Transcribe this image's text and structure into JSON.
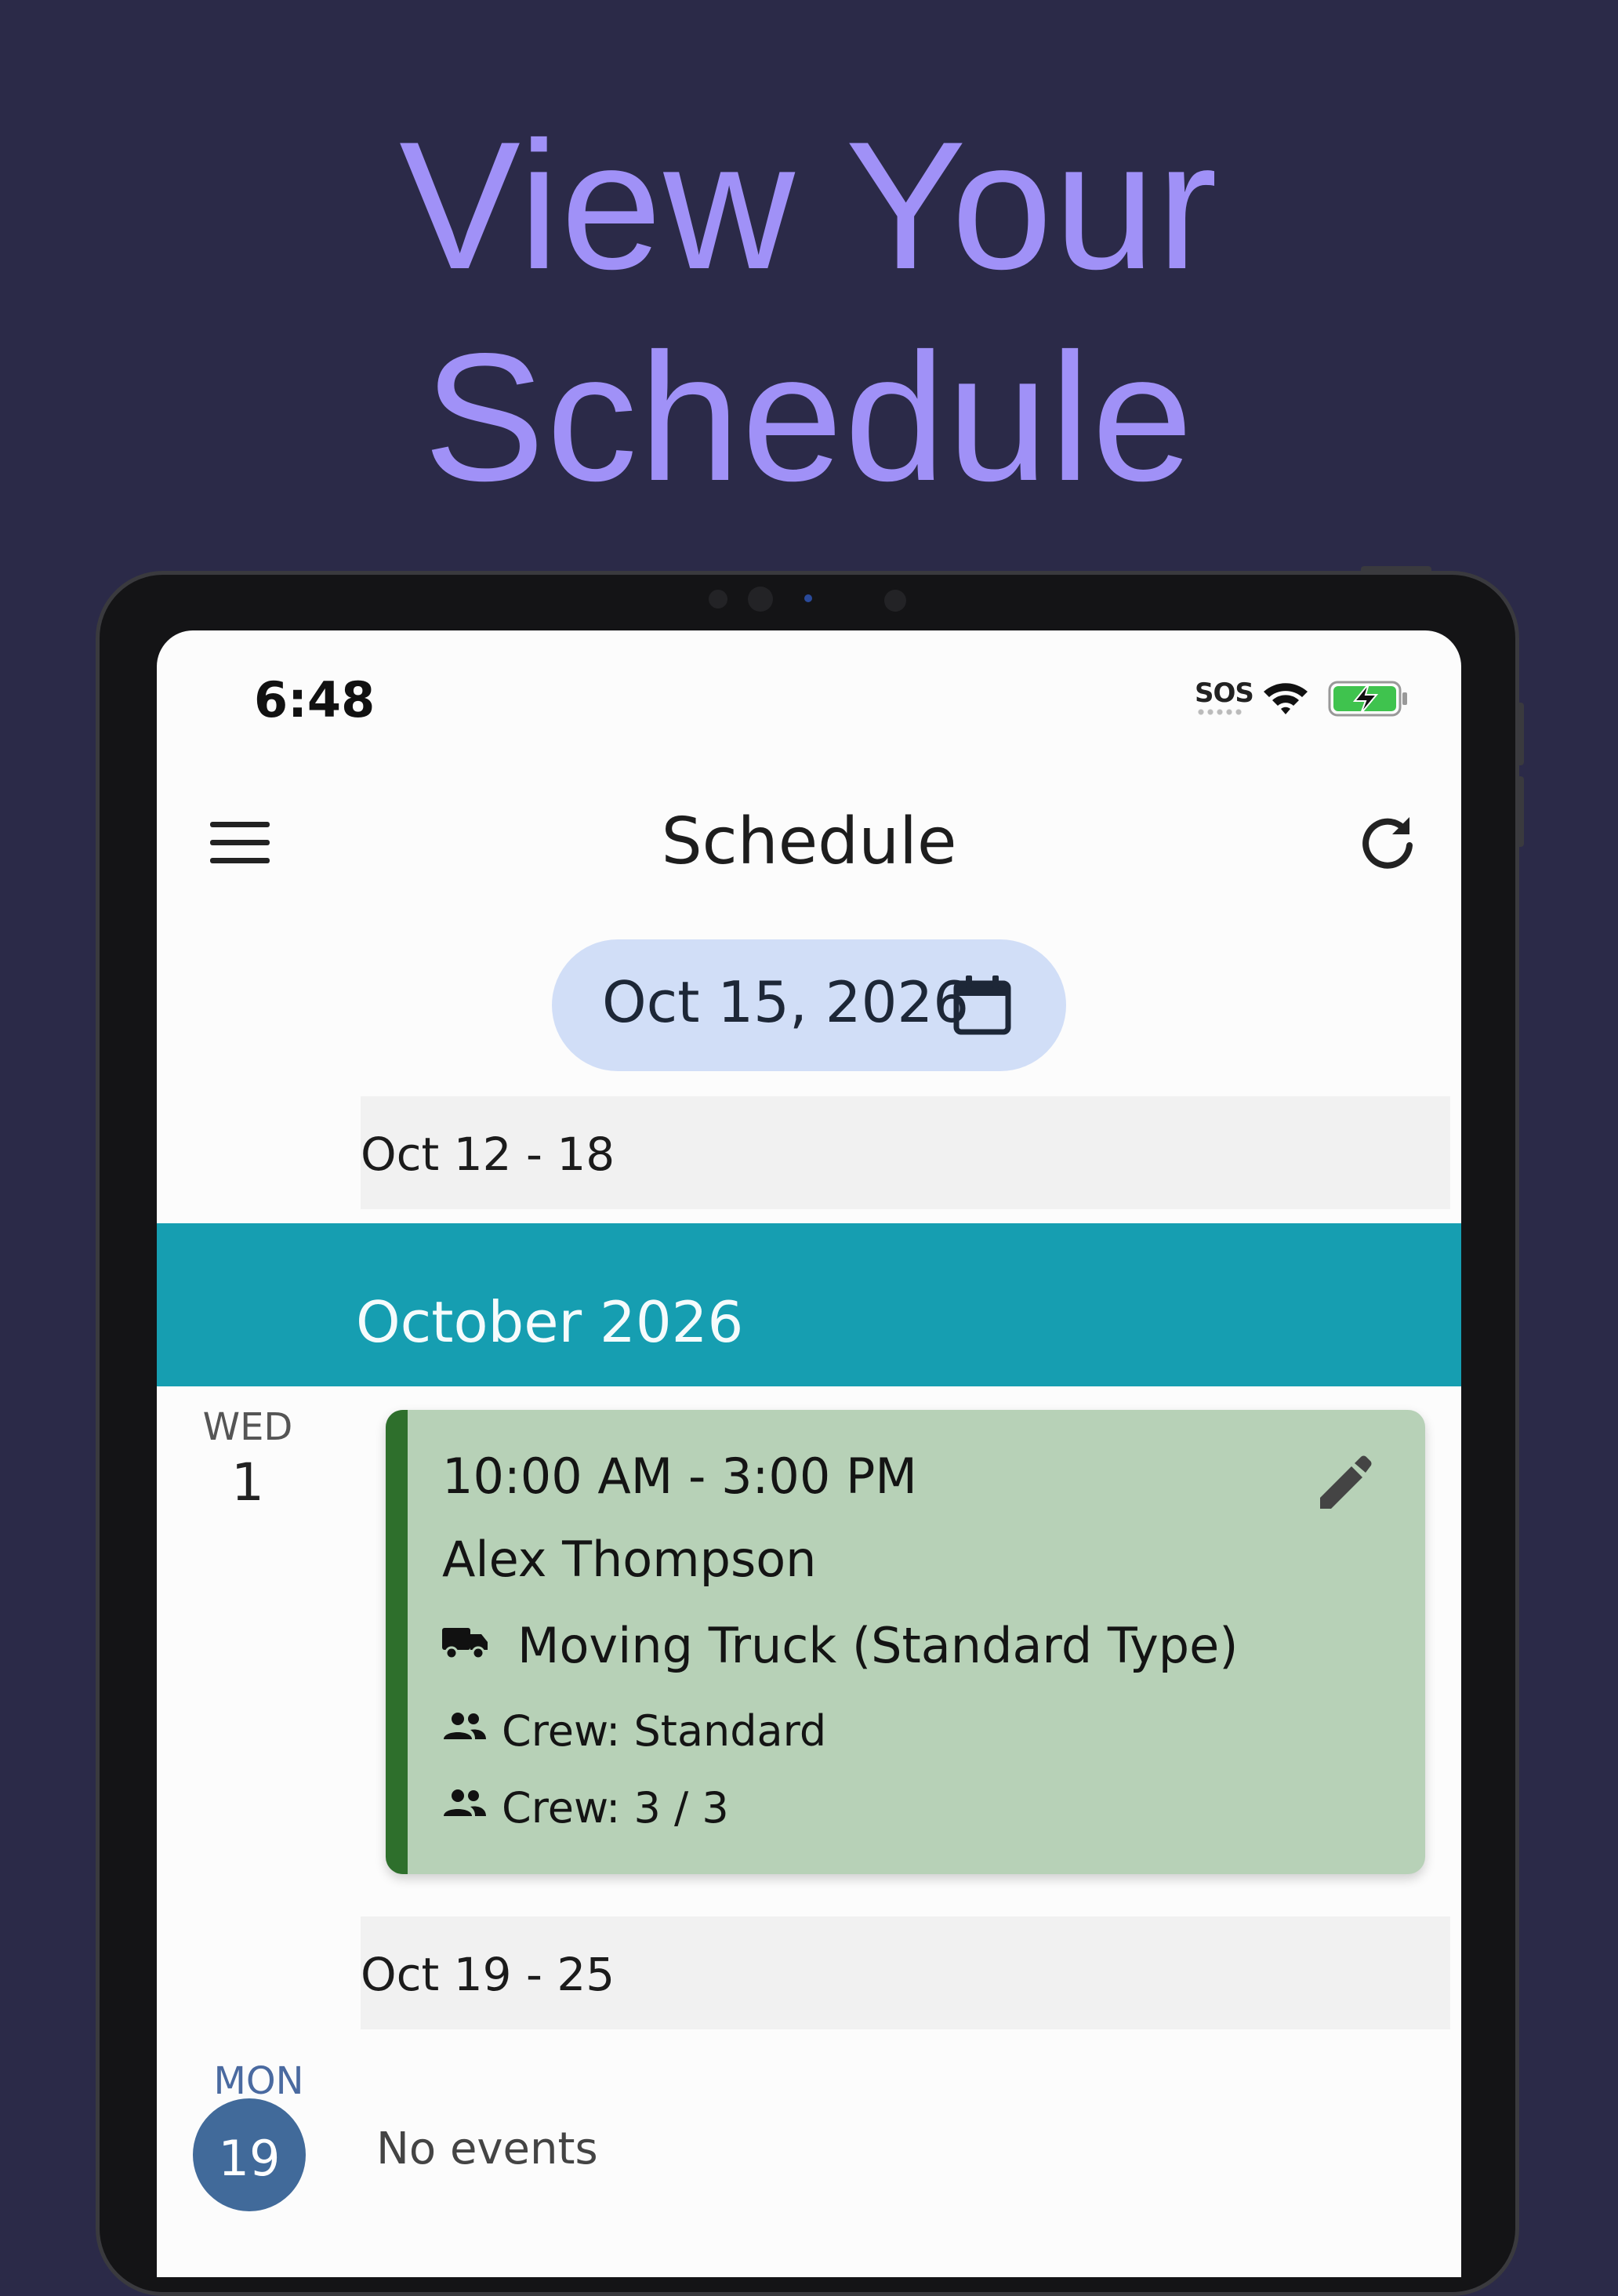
{
  "headline": {
    "line1": "View Your",
    "line2": "Schedule"
  },
  "status_bar": {
    "time": "6:48",
    "sos": "SOS"
  },
  "app_bar": {
    "title": "Schedule"
  },
  "date_picker": {
    "label": "Oct 15, 2026"
  },
  "weeks": [
    {
      "range": "Oct 12 - 18"
    },
    {
      "range": "Oct 19 - 25"
    }
  ],
  "month_header": "October 2026",
  "days": [
    {
      "dow": "WED",
      "dom": "1",
      "event": {
        "time": "10:00 AM - 3:00 PM",
        "name": "Alex Thompson",
        "vehicle": "Moving Truck (Standard Type)",
        "crew_type": "Crew: Standard",
        "crew_count": "Crew: 3 / 3"
      }
    },
    {
      "dow": "MON",
      "dom": "19",
      "empty_text": "No events"
    }
  ],
  "colors": {
    "background": "#2b2a48",
    "headline": "#a091f7",
    "month_band": "#169eb1",
    "date_pill": "#d1def7",
    "event_card": "#b7d1b7",
    "event_accent": "#2e6f2c",
    "today_circle": "#416a9a"
  },
  "icons": [
    "menu-icon",
    "refresh-icon",
    "calendar-icon",
    "edit-icon",
    "truck-icon",
    "people-icon",
    "wifi-icon",
    "battery-charging-icon"
  ]
}
